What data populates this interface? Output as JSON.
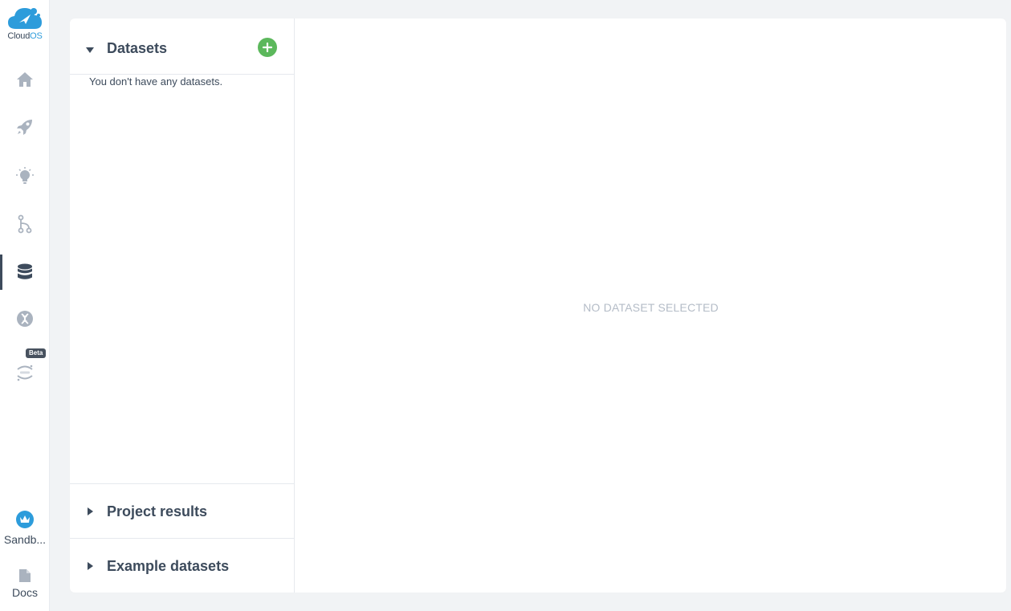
{
  "app": {
    "logo_main": "Cloud",
    "logo_accent": "OS",
    "beta_badge": "Beta"
  },
  "rail_bottom": {
    "sandbox_label": "Sandb...",
    "docs_label": "Docs"
  },
  "datasets_panel": {
    "title": "Datasets",
    "empty_message": "You don't have any datasets."
  },
  "sections": {
    "project_results": "Project results",
    "example_datasets": "Example datasets"
  },
  "main": {
    "placeholder": "NO DATASET SELECTED"
  },
  "colors": {
    "accent": "#2d9cdb",
    "add_button": "#5cb85c",
    "text": "#3d4b5c",
    "icon": "#aab3bf"
  }
}
